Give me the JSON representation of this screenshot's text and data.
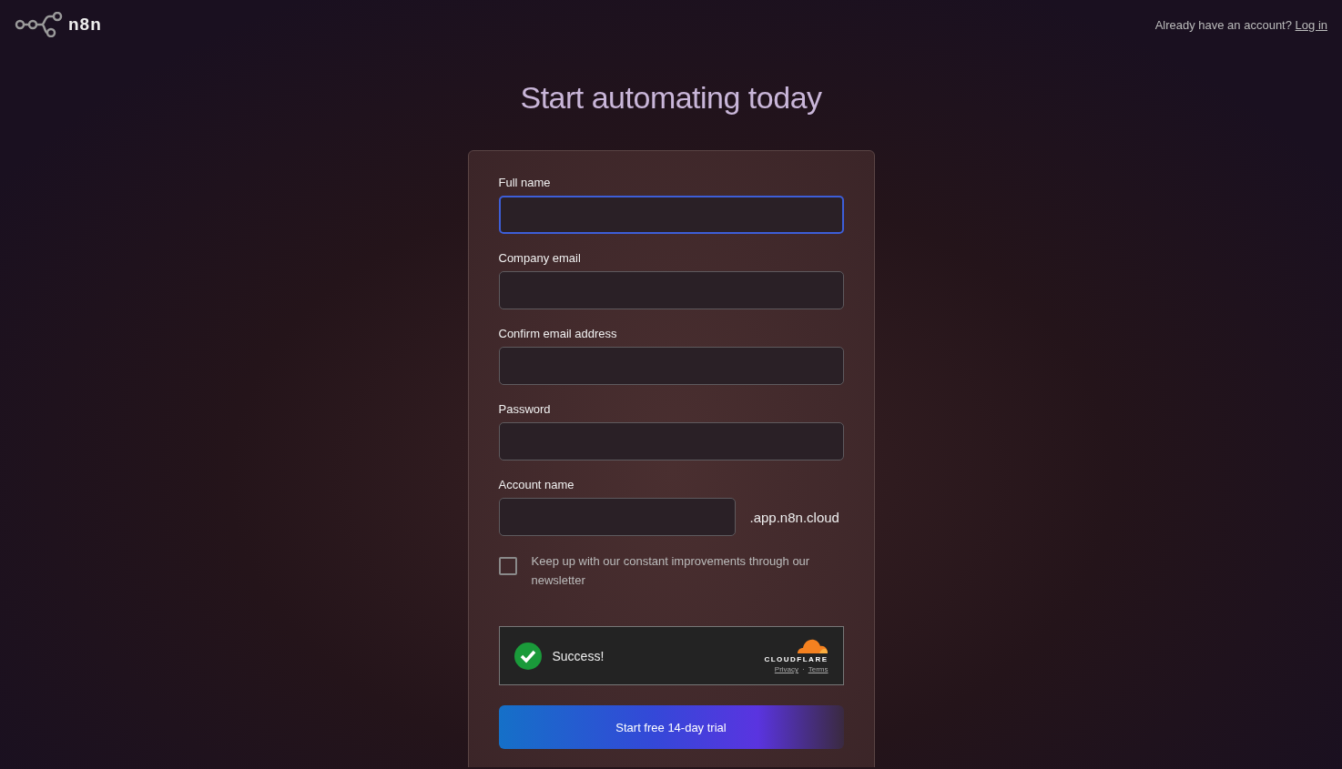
{
  "header": {
    "logo_text": "n8n",
    "prompt": "Already have an account?",
    "login_link": "Log in"
  },
  "title": "Start automating today",
  "fields": [
    {
      "label": "Full name",
      "kind": "text",
      "focused": true
    },
    {
      "label": "Company email",
      "kind": "text",
      "focused": false
    },
    {
      "label": "Confirm email address",
      "kind": "text",
      "focused": false
    },
    {
      "label": "Password",
      "kind": "text",
      "focused": false
    },
    {
      "label": "Account name",
      "kind": "subdomain",
      "focused": false,
      "suffix": ".app.n8n.cloud"
    }
  ],
  "newsletter": {
    "label": "Keep up with our constant improvements through our newsletter",
    "checked": false
  },
  "captcha": {
    "status": "Success!",
    "brand": "CLOUDFLARE",
    "links": [
      "Privacy",
      "Terms"
    ],
    "separator": "·"
  },
  "submit_button": "Start free 14-day trial"
}
